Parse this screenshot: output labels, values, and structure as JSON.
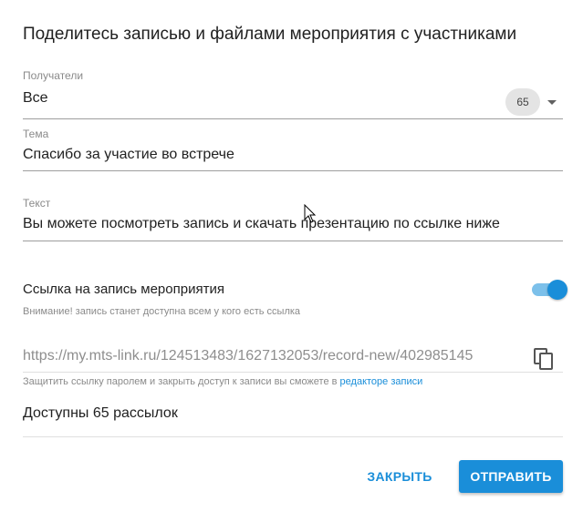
{
  "dialog": {
    "title": "Поделитесь записью и файлами мероприятия с участниками"
  },
  "recipients": {
    "label": "Получатели",
    "value": "Все",
    "count": "65"
  },
  "subject": {
    "label": "Тема",
    "value": "Спасибо за участие во встрече"
  },
  "text": {
    "label": "Текст",
    "value": "Вы можете посмотреть запись и скачать презентацию по ссылке ниже"
  },
  "record_link": {
    "label": "Ссылка на запись мероприятия",
    "enabled": true,
    "warning": "Внимание! запись станет доступна всем у кого есть ссылка",
    "url": "https://my.mts-link.ru/124513483/1627132053/record-new/402985145",
    "protect_hint": "Защитить ссылку паролем и закрыть доступ к записи вы сможете в",
    "editor_link": "редакторе записи"
  },
  "mailings": {
    "available": "Доступны 65 рассылок"
  },
  "actions": {
    "close_label": "ЗАКРЫТЬ",
    "send_label": "ОТПРАВИТЬ"
  },
  "colors": {
    "accent": "#1a8ed9",
    "toggle_track": "#7cc0ea"
  },
  "icons": {
    "dropdown": "chevron-down-icon",
    "copy": "copy-icon",
    "cursor": "mouse-cursor-icon"
  }
}
